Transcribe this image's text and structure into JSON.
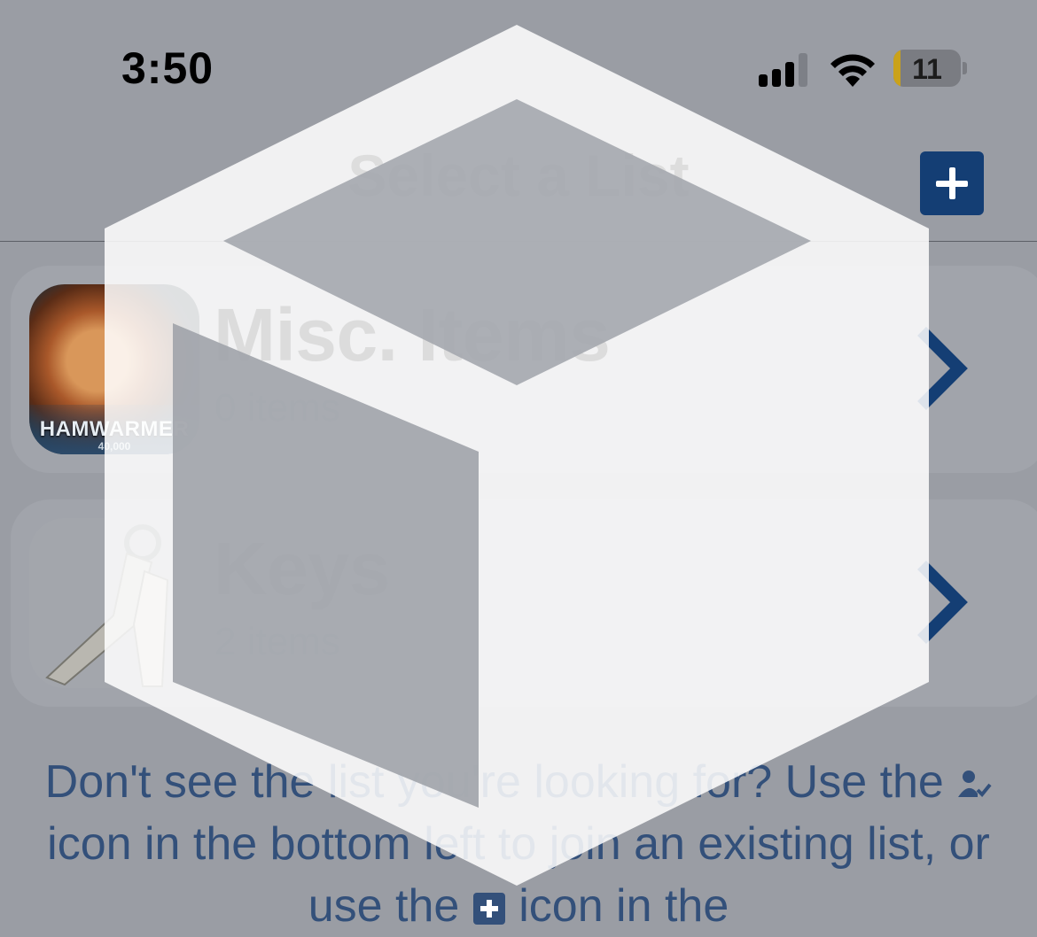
{
  "status_bar": {
    "time": "3:50",
    "battery_level": "11",
    "icons": [
      "cellular-signal-icon",
      "wifi-icon",
      "battery-icon"
    ]
  },
  "nav": {
    "title": "Select a List",
    "add_button_icon": "plus-icon"
  },
  "lists": [
    {
      "name": "Misc. Items",
      "count": "0 items",
      "thumbnail_text": "HAMWARMER",
      "thumbnail_subtext": "40,000",
      "chevron_icon": "chevron-right-icon"
    },
    {
      "name": "Keys",
      "count": "2 items",
      "chevron_icon": "chevron-right-icon"
    }
  ],
  "footer": {
    "part1": "Don't see the list you're looking for? Use the",
    "part2": "icon in the bottom left to join an existing list, or use the",
    "part3": "icon in the",
    "join_icon": "person-check-icon",
    "add_icon": "plus-square-icon"
  },
  "colors": {
    "accent": "#143e74",
    "secondary_text": "#33507a",
    "background": "#9a9da4"
  }
}
